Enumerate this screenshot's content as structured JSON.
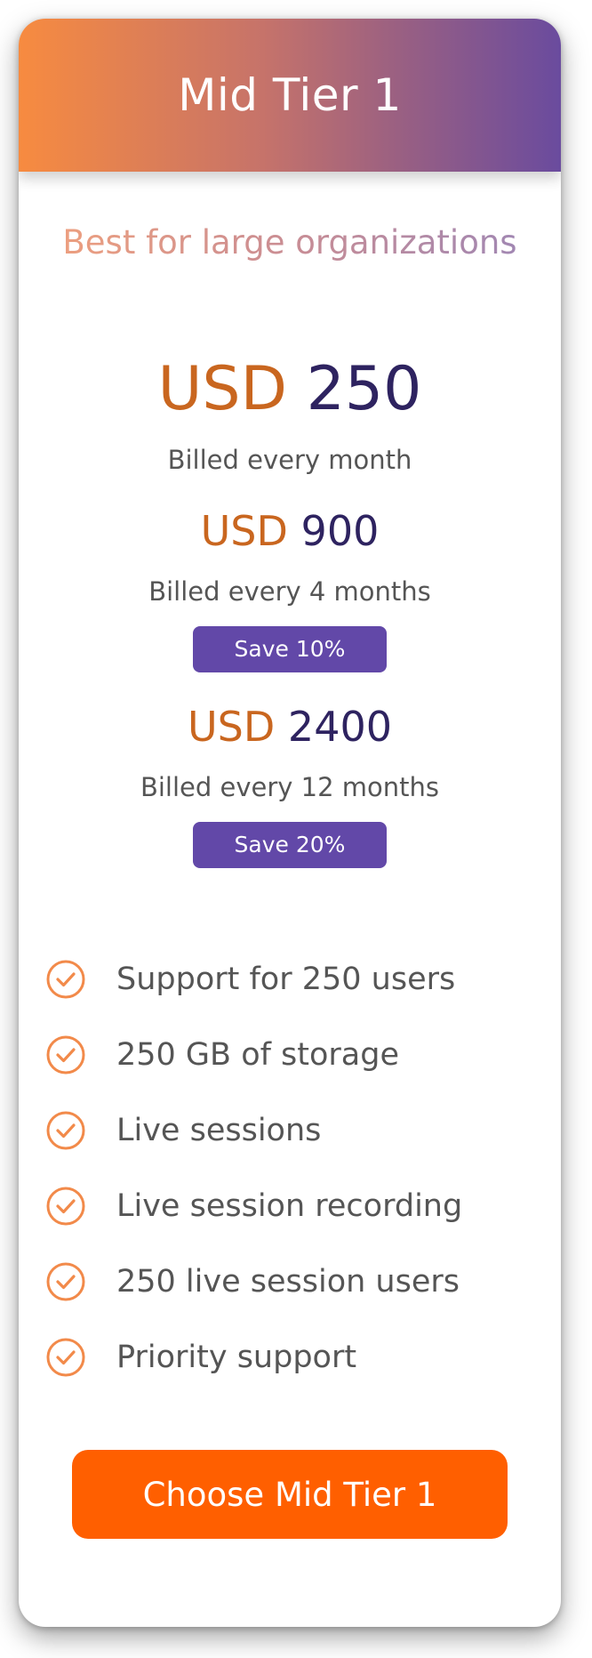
{
  "plan": {
    "title": "Mid Tier 1",
    "tagline": "Best for large organizations"
  },
  "pricing": [
    {
      "currency": "USD",
      "amount": "250",
      "billing": "Billed every month"
    },
    {
      "currency": "USD",
      "amount": "900",
      "billing": "Billed every 4 months",
      "badge": "Save 10%"
    },
    {
      "currency": "USD",
      "amount": "2400",
      "billing": "Billed every 12 months",
      "badge": "Save 20%"
    }
  ],
  "features": [
    {
      "label": "Support for 250 users",
      "icon": "check-circle-icon"
    },
    {
      "label": "250 GB of storage",
      "icon": "check-circle-icon"
    },
    {
      "label": "Live sessions",
      "icon": "check-circle-icon"
    },
    {
      "label": "Live session recording",
      "icon": "check-circle-icon"
    },
    {
      "label": "250 live session users",
      "icon": "check-circle-icon"
    },
    {
      "label": "Priority support",
      "icon": "check-circle-icon"
    }
  ],
  "cta": {
    "label": "Choose Mid Tier 1"
  },
  "colors": {
    "header_gradient_start": "#f78b40",
    "header_gradient_end": "#6a4b9e",
    "currency": "#c9661f",
    "amount": "#2e2360",
    "badge": "#6248a8",
    "check": "#f28a4a",
    "cta": "#ff5f00"
  }
}
